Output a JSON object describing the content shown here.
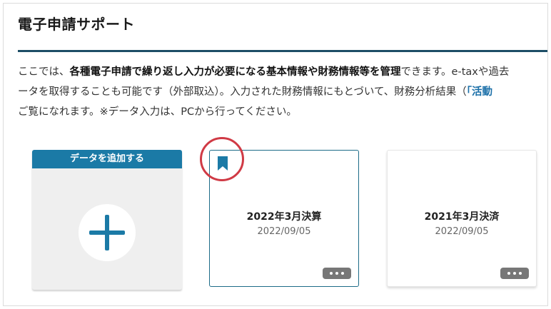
{
  "header": {
    "title": "電子申請サポート"
  },
  "description": {
    "line1_pre": "ここでは、",
    "line1_bold": "各種電子申請で繰り返し入力が必要になる基本情報や財務情報等を管理",
    "line1_post": "できます。e-taxや過去",
    "line2_pre": "ータを取得することも可能です（外部取込）。入力された財務情報にもとづいて、財務分析結果（",
    "line2_link": "「活動",
    "line3": "ご覧になれます。※データ入力は、PCから行ってください。"
  },
  "add_card": {
    "label": "データを追加する",
    "icon": "plus-icon"
  },
  "cards": [
    {
      "title": "2022年3月決算",
      "date": "2022/09/05",
      "bookmarked": true,
      "highlighted": true
    },
    {
      "title": "2021年3月決済",
      "date": "2022/09/05",
      "bookmarked": false,
      "highlighted": false
    }
  ],
  "colors": {
    "accent": "#1b7aa6",
    "rule": "#1d4e66",
    "highlight": "#d03a45",
    "link": "#1a6fa8"
  }
}
